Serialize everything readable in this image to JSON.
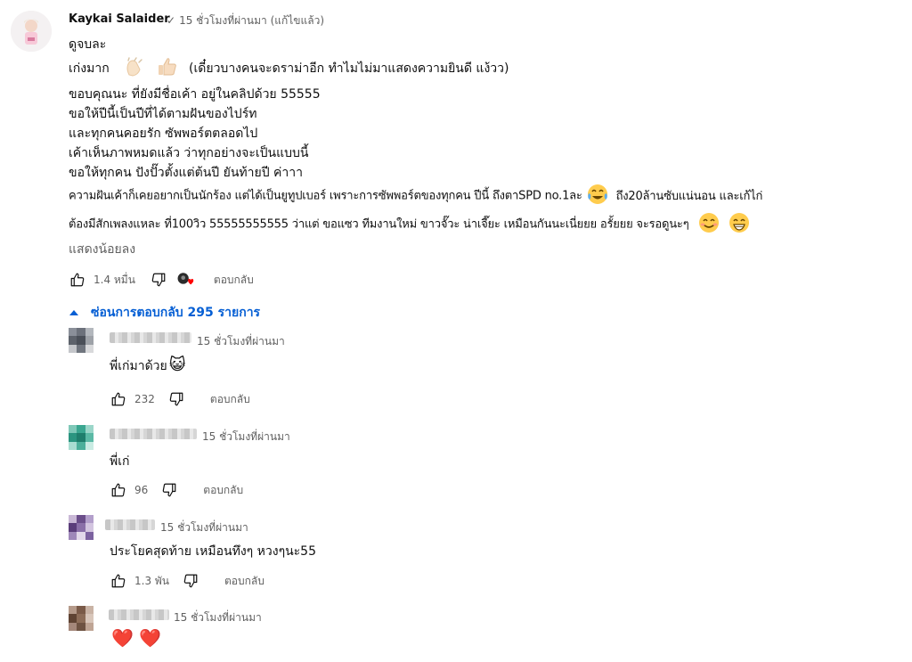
{
  "comment": {
    "author": "Kaykai Salaider",
    "time": "15 ชั่วโมงที่ผ่านมา (แก้ไขแล้ว)",
    "lines": [
      "ดูจบละ",
      "เก่งมาก",
      "(เดี๋ยวบางคนจะดราม่าอีก ทำไมไม่มาแสดงความยินดี แง้วว)",
      "ขอบคุณนะ ที่ยังมีชื่อเค้า อยู่ในคลิปด้วย 55555",
      "ขอให้ปีนี้เป็นปีที่ได้ตามฝันของไปร์ท",
      "และทุกคนคอยรัก ซัพพอร์ตตลอดไป",
      "เค้าเห็นภาพหมดแล้ว ว่าทุกอย่างจะเป็นแบบนี้",
      "ขอให้ทุกคน ปังปั๊วตั้งแต่ต้นปี ยันท้ายปี ค่าาา",
      "ความฝันเค้าก็เคยอยากเป็นนักร้อง แต่ได้เป็นยูทูปเบอร์ เพราะการซัพพอร์ตของทุกคน ปีนี้ ถึงตาSPD no.1ละ",
      "ถึง20ล้านซับแน่นอน และเก้ไก่",
      "ต้องมีสักเพลงแหละ ที่100วิว 55555555555 ว่าแต่ ขอแซว ทีมงานใหม่ ขาวจั๊วะ น่าเจี๊ยะ เหมือนกันนะเนี่ยยย อรั้ยยย จะรอดูนะๆ"
    ],
    "show_less": "แสดงน้อยลง",
    "likes": "1.4 หมื่น",
    "reply_label": "ตอบกลับ",
    "icons": {
      "like": "thumb-up-icon",
      "dislike": "thumb-down-icon",
      "creator_heart": "creator-heart-icon",
      "verified": "check-icon"
    }
  },
  "replies_toggle": "ซ่อนการตอบกลับ 295 รายการ",
  "replies": [
    {
      "time": "15 ชั่วโมงที่ผ่านมา",
      "text": "พี่เก่มาด้วย",
      "likes": "232",
      "reply_label": "ตอบกลับ",
      "emoji": "😺"
    },
    {
      "time": "15 ชั่วโมงที่ผ่านมา",
      "text": "พี่เก่",
      "likes": "96",
      "reply_label": "ตอบกลับ"
    },
    {
      "time": "15 ชั่วโมงที่ผ่านมา",
      "text": "ประโยคสุดท้าย เหมือนทึงๆ หวงๆนะ55",
      "likes": "1.3 พัน",
      "reply_label": "ตอบกลับ"
    },
    {
      "time": "15 ชั่วโมงที่ผ่านมา",
      "text": "❤️ ❤️"
    }
  ],
  "colors": {
    "link": "#065fd4",
    "meta": "#606060",
    "text": "#0f0f0f"
  }
}
